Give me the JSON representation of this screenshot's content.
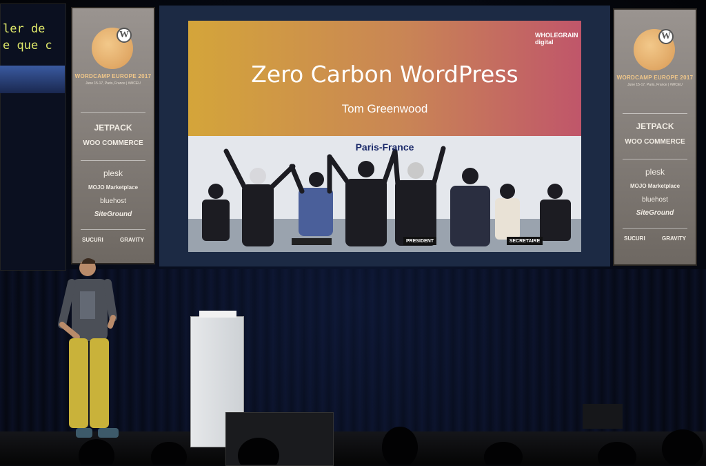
{
  "side_screen": {
    "lines": [
      "ler de",
      "e que c"
    ]
  },
  "banner": {
    "event_title": "WORDCAMP EUROPE 2017",
    "event_subtitle": "June 15-17, Paris, France | #WCEU",
    "sponsors": [
      "JETPACK",
      "WOO COMMERCE",
      "plesk",
      "MOJO Marketplace",
      "bluehost",
      "SiteGround",
      "SUCURI",
      "GRAVITY"
    ]
  },
  "slide": {
    "logo_line1": "WHOLEGRAIN",
    "logo_line2": "digital",
    "title": "Zero Carbon WordPress",
    "speaker": "Tom Greenwood",
    "photo_caption": "Paris-France",
    "photo_labels": [
      "PRESIDENT",
      "SECRETAIRE"
    ]
  },
  "colors": {
    "slide_gradient_start": "#d4a53a",
    "slide_gradient_end": "#c0566a",
    "caption_color": "#1b2a6a",
    "banner_accent": "#f2c88a"
  }
}
